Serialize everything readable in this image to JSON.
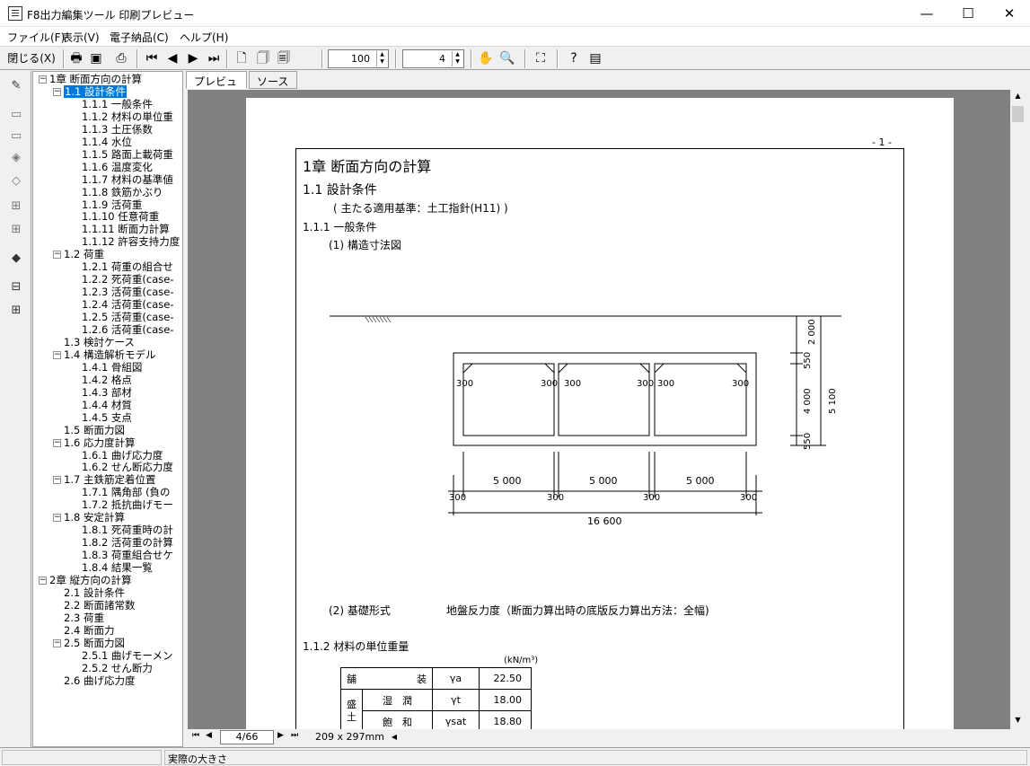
{
  "window": {
    "title": "F8出力編集ツール 印刷プレビュー",
    "minimize": "—",
    "maximize": "☐",
    "close": "✕"
  },
  "menu": [
    "ファイル(F)",
    "表示(V)",
    "電子納品(C)",
    "ヘルプ(H)"
  ],
  "toolbar": {
    "close_label": "閉じる(X)",
    "zoom_value": "100",
    "page_spin_value": "4"
  },
  "tabs": [
    "プレビュー",
    "ソース"
  ],
  "tree": [
    {
      "label": "1章 断面方向の計算",
      "level": 0,
      "exp": "−"
    },
    {
      "label": "1.1 設計条件",
      "level": 1,
      "exp": "−",
      "selected": true
    },
    {
      "label": "1.1.1 一般条件",
      "level": 2
    },
    {
      "label": "1.1.2 材料の単位重",
      "level": 2
    },
    {
      "label": "1.1.3 土圧係数",
      "level": 2
    },
    {
      "label": "1.1.4 水位",
      "level": 2
    },
    {
      "label": "1.1.5 路面上載荷重",
      "level": 2
    },
    {
      "label": "1.1.6 温度変化",
      "level": 2
    },
    {
      "label": "1.1.7 材料の基準値",
      "level": 2
    },
    {
      "label": "1.1.8 鉄筋かぶり",
      "level": 2
    },
    {
      "label": "1.1.9 活荷重",
      "level": 2
    },
    {
      "label": "1.1.10 任意荷重",
      "level": 2
    },
    {
      "label": "1.1.11 断面力計算",
      "level": 2
    },
    {
      "label": "1.1.12 許容支持力度",
      "level": 2
    },
    {
      "label": "1.2 荷重",
      "level": 1,
      "exp": "−"
    },
    {
      "label": "1.2.1 荷重の組合せ",
      "level": 2
    },
    {
      "label": "1.2.2 死荷重(case-",
      "level": 2
    },
    {
      "label": "1.2.3 活荷重(case-",
      "level": 2
    },
    {
      "label": "1.2.4 活荷重(case-",
      "level": 2
    },
    {
      "label": "1.2.5 活荷重(case-",
      "level": 2
    },
    {
      "label": "1.2.6 活荷重(case-",
      "level": 2
    },
    {
      "label": "1.3 検討ケース",
      "level": 1
    },
    {
      "label": "1.4 構造解析モデル",
      "level": 1,
      "exp": "−"
    },
    {
      "label": "1.4.1 骨組図",
      "level": 2
    },
    {
      "label": "1.4.2 格点",
      "level": 2
    },
    {
      "label": "1.4.3 部材",
      "level": 2
    },
    {
      "label": "1.4.4 材質",
      "level": 2
    },
    {
      "label": "1.4.5 支点",
      "level": 2
    },
    {
      "label": "1.5 断面力図",
      "level": 1
    },
    {
      "label": "1.6 応力度計算",
      "level": 1,
      "exp": "−"
    },
    {
      "label": "1.6.1 曲げ応力度",
      "level": 2
    },
    {
      "label": "1.6.2 せん断応力度",
      "level": 2
    },
    {
      "label": "1.7 主鉄筋定着位置",
      "level": 1,
      "exp": "−"
    },
    {
      "label": "1.7.1 隅角部 (負の",
      "level": 2
    },
    {
      "label": "1.7.2 抵抗曲げモー",
      "level": 2
    },
    {
      "label": "1.8 安定計算",
      "level": 1,
      "exp": "−"
    },
    {
      "label": "1.8.1 死荷重時の計",
      "level": 2
    },
    {
      "label": "1.8.2 活荷重の計算",
      "level": 2
    },
    {
      "label": "1.8.3 荷重組合せケ",
      "level": 2
    },
    {
      "label": "1.8.4 結果一覧",
      "level": 2
    },
    {
      "label": "2章 縦方向の計算",
      "level": 0,
      "exp": "−"
    },
    {
      "label": "2.1 設計条件",
      "level": 1
    },
    {
      "label": "2.2 断面諸常数",
      "level": 1
    },
    {
      "label": "2.3 荷重",
      "level": 1
    },
    {
      "label": "2.4 断面力",
      "level": 1
    },
    {
      "label": "2.5 断面力図",
      "level": 1,
      "exp": "−"
    },
    {
      "label": "2.5.1 曲げモーメン",
      "level": 2
    },
    {
      "label": "2.5.2 せん断力",
      "level": 2
    },
    {
      "label": "2.6 曲げ応力度",
      "level": 1
    }
  ],
  "page": {
    "page_number": "- 1 -",
    "chapter": "1章 断面方向の計算",
    "section": "1.1 設計条件",
    "standard": "( 主たる適用基準：土工指針(H11) )",
    "sub1": "1.1.1 一般条件",
    "item1": "(1) 構造寸法図",
    "item2_label": "(2) 基礎形式",
    "item2_value": "地盤反力度（断面力算出時の底版反力算出方法：全幅)",
    "sub2": "1.1.2 材料の単位重量",
    "unit": "(kN/m³)",
    "table": [
      {
        "group": "舗",
        "name": "装",
        "sym": "γa",
        "val": "22.50"
      },
      {
        "group": "盛",
        "name": "湿　潤",
        "sym": "γt",
        "val": "18.00"
      },
      {
        "group": "土",
        "name": "飽　和",
        "sym": "γsat",
        "val": "18.80"
      }
    ],
    "dims": {
      "h_top": "2 000",
      "h_550a": "550",
      "h_4000": "4 000",
      "h_5100": "5 100",
      "h_550b": "550",
      "haunch": "300",
      "w_5000": "5 000",
      "w_300": "300",
      "total": "16 600"
    }
  },
  "nav": {
    "page_field": "4/66",
    "paper_size": "209 x 297mm"
  },
  "status": {
    "text": "実際の大きさ"
  }
}
